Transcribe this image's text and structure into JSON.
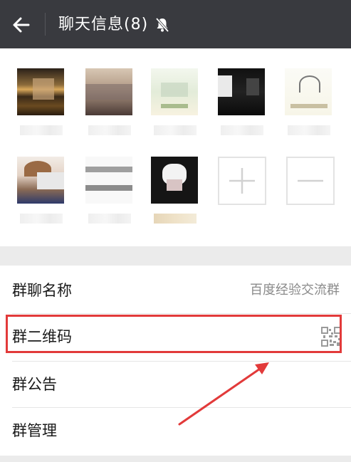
{
  "header": {
    "title": "聊天信息(8)",
    "back_icon": "arrow-left-icon",
    "mute_icon": "bell-off-icon",
    "bg_color": "#393a3f"
  },
  "members": {
    "add_icon": "plus-icon",
    "remove_icon": "minus-icon"
  },
  "settings": {
    "group_name_label": "群聊名称",
    "group_name_value": "百度经验交流群",
    "qr_label": "群二维码",
    "qr_icon": "qr-code-icon",
    "notice_label": "群公告",
    "manage_label": "群管理"
  },
  "annotation": {
    "highlight_color": "#e23a3a"
  }
}
